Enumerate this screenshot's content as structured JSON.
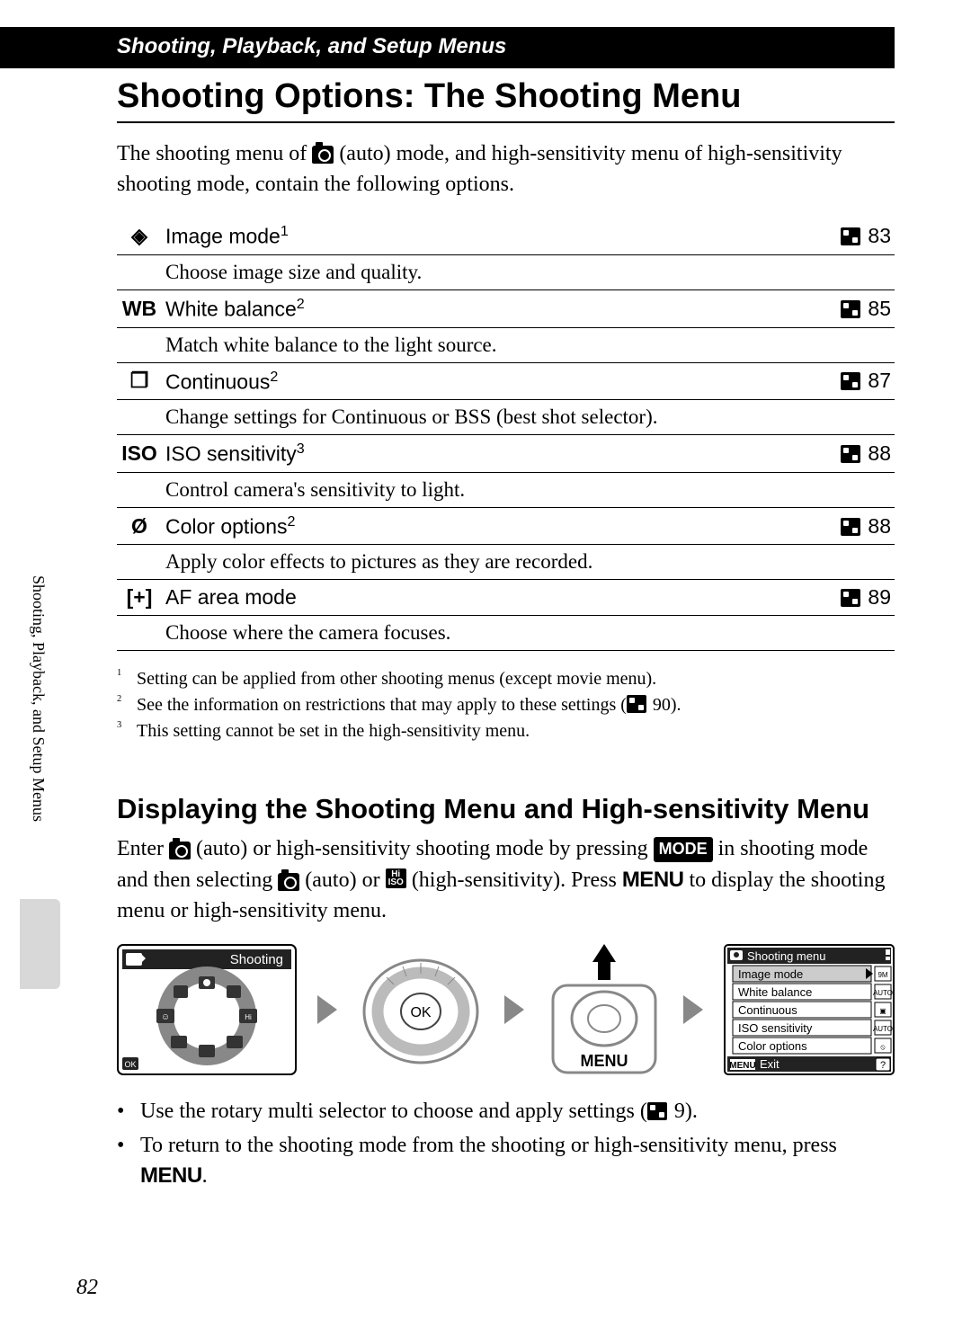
{
  "breadcrumb": "Shooting, Playback, and Setup Menus",
  "title": "Shooting Options: The Shooting Menu",
  "intro_a": "The shooting menu of ",
  "intro_b": " (auto) mode, and high-sensitivity menu of high-sensitivity shooting mode, contain the following options.",
  "options": [
    {
      "icon": "◈",
      "name": "Image mode",
      "sup": "1",
      "desc": "Choose image size and quality.",
      "page": "83"
    },
    {
      "icon": "WB",
      "name": "White balance",
      "sup": "2",
      "desc": "Match white balance to the light source.",
      "page": "85"
    },
    {
      "icon": "❐",
      "name": "Continuous",
      "sup": "2",
      "desc": "Change settings for Continuous or BSS (best shot selector).",
      "page": "87"
    },
    {
      "icon": "ISO",
      "name": "ISO sensitivity",
      "sup": "3",
      "desc": "Control camera's sensitivity to light.",
      "page": "88"
    },
    {
      "icon": "Ø",
      "name": "Color options",
      "sup": "2",
      "desc": "Apply color effects to pictures as they are recorded.",
      "page": "88"
    },
    {
      "icon": "[+]",
      "name": "AF area mode",
      "sup": "",
      "desc": "Choose where the camera focuses.",
      "page": "89"
    }
  ],
  "footnotes": [
    {
      "num": "1",
      "text": "Setting can be applied from other shooting menus (except movie menu)."
    },
    {
      "num": "2",
      "text_a": "See the information on restrictions that may apply to these settings (",
      "ref": "90",
      "text_b": ")."
    },
    {
      "num": "3",
      "text": "This setting cannot be set in the high-sensitivity menu."
    }
  ],
  "section_title": "Displaying the Shooting Menu and High-sensitivity Menu",
  "section_body": {
    "a": "Enter ",
    "b": " (auto) or high-sensitivity shooting mode by pressing ",
    "mode": "MODE",
    "c": " in shooting mode and then selecting ",
    "d": " (auto) or ",
    "e": " (high-sensitivity). Press ",
    "menu1": "MENU",
    "f": " to display the shooting menu or high-sensitivity menu."
  },
  "flow": {
    "screen1_label": "Shooting",
    "ok_label": "OK",
    "menu_label": "MENU",
    "menu_panel": {
      "title": "Shooting menu",
      "items": [
        "Image mode",
        "White balance",
        "Continuous",
        "ISO sensitivity",
        "Color options"
      ],
      "badges": [
        "9M",
        "AUTO",
        "▣",
        "AUTO",
        "⦸"
      ],
      "exit_prefix": "MENU",
      "exit": "Exit"
    }
  },
  "bullets": [
    {
      "a": "Use the rotary multi selector to choose and apply settings (",
      "ref": "9",
      "b": ")."
    },
    {
      "a": "To return to the shooting mode from the shooting or high-sensitivity menu, press ",
      "menu": "MENU",
      "b": "."
    }
  ],
  "side_label": "Shooting, Playback, and Setup Menus",
  "page_number": "82"
}
